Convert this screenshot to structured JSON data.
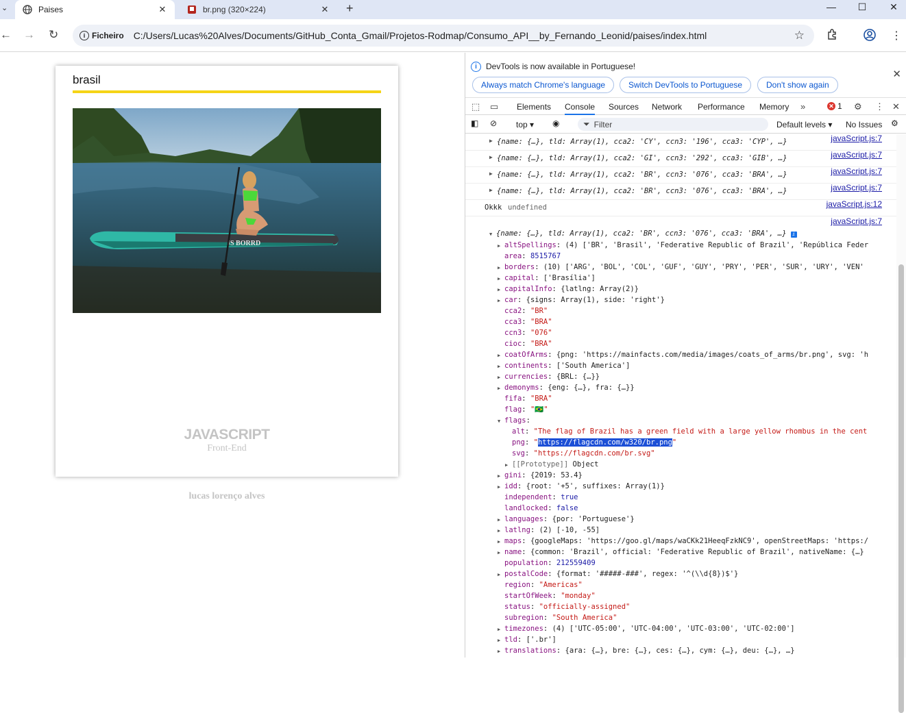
{
  "browser": {
    "tabs": [
      {
        "title": "Paises",
        "active": true
      },
      {
        "title": "br.png (320×224)",
        "active": false
      }
    ],
    "omnibox": {
      "chip": "Ficheiro",
      "url": "C:/Users/Lucas%20Alves/Documents/GitHub_Conta_Gmail/Projetos-Rodmap/Consumo_API__by_Fernando_Leonid/paises/index.html"
    }
  },
  "page": {
    "search_value": "brasil",
    "brand_main": "JAVASCRIPT",
    "brand_sub": "Front-End",
    "author": "lucas lorenço alves",
    "photo_text": "JS BORRD"
  },
  "devtools": {
    "info_message": "DevTools is now available in Portuguese!",
    "buttons": [
      "Always match Chrome's language",
      "Switch DevTools to Portuguese",
      "Don't show again"
    ],
    "tabs": [
      "Elements",
      "Console",
      "Sources",
      "Network",
      "Performance",
      "Memory"
    ],
    "error_count": "1",
    "context": "top",
    "filter_placeholder": "Filter",
    "levels": "Default levels",
    "issues": "No Issues"
  },
  "console": {
    "summary_rows": [
      {
        "text": "{name: {…}, tld: Array(1), cca2: 'CY', ccn3: '196', cca3: 'CYP', …}",
        "source": "javaScript.js:7"
      },
      {
        "text": "{name: {…}, tld: Array(1), cca2: 'GI', ccn3: '292', cca3: 'GIB', …}",
        "source": "javaScript.js:7"
      },
      {
        "text": "{name: {…}, tld: Array(1), cca2: 'BR', ccn3: '076', cca3: 'BRA', …}",
        "source": "javaScript.js:7"
      },
      {
        "text": "{name: {…}, tld: Array(1), cca2: 'BR', ccn3: '076', cca3: 'BRA', …}",
        "source": "javaScript.js:7"
      }
    ],
    "okkk": {
      "label": "Okkk",
      "value": "undefined",
      "source": "javaScript.js:12"
    },
    "expanded_source": "javaScript.js:7",
    "expanded_header": "{name: {…}, tld: Array(1), cca2: 'BR', ccn3: '076', cca3: 'BRA', …}",
    "props": [
      {
        "t": 1,
        "k": "altSpellings",
        "v": "(4) ['BR', 'Brasil', 'Federative Republic of Brazil', 'República Feder"
      },
      {
        "t": 0,
        "k": "area",
        "v": "8515767"
      },
      {
        "t": 1,
        "k": "borders",
        "v": "(10) ['ARG', 'BOL', 'COL', 'GUF', 'GUY', 'PRY', 'PER', 'SUR', 'URY', 'VEN'"
      },
      {
        "t": 1,
        "k": "capital",
        "v": "['Brasília']"
      },
      {
        "t": 1,
        "k": "capitalInfo",
        "v": "{latlng: Array(2)}"
      },
      {
        "t": 1,
        "k": "car",
        "v": "{signs: Array(1), side: 'right'}"
      },
      {
        "t": 0,
        "k": "cca2",
        "v": "\"BR\""
      },
      {
        "t": 0,
        "k": "cca3",
        "v": "\"BRA\""
      },
      {
        "t": 0,
        "k": "ccn3",
        "v": "\"076\""
      },
      {
        "t": 0,
        "k": "cioc",
        "v": "\"BRA\""
      },
      {
        "t": 1,
        "k": "coatOfArms",
        "v": "{png: 'https://mainfacts.com/media/images/coats_of_arms/br.png', svg: 'h"
      },
      {
        "t": 1,
        "k": "continents",
        "v": "['South America']"
      },
      {
        "t": 1,
        "k": "currencies",
        "v": "{BRL: {…}}"
      },
      {
        "t": 1,
        "k": "demonyms",
        "v": "{eng: {…}, fra: {…}}"
      },
      {
        "t": 0,
        "k": "fifa",
        "v": "\"BRA\""
      },
      {
        "t": 0,
        "k": "flag",
        "v": "\"🇧🇷\""
      },
      {
        "t": 2,
        "k": "flags",
        "v": ""
      },
      {
        "t": 3,
        "k": "alt",
        "v": "\"The flag of Brazil has a green field with a large yellow rhombus in the cent"
      },
      {
        "t": 4,
        "k": "png",
        "v": "https://flagcdn.com/w320/br.png"
      },
      {
        "t": 3,
        "k": "svg",
        "v": "\"https://flagcdn.com/br.svg\""
      },
      {
        "t": 5,
        "k": "[[Prototype]]",
        "v": "Object"
      },
      {
        "t": 1,
        "k": "gini",
        "v": "{2019: 53.4}"
      },
      {
        "t": 1,
        "k": "idd",
        "v": "{root: '+5', suffixes: Array(1)}"
      },
      {
        "t": 0,
        "k": "independent",
        "v": "true"
      },
      {
        "t": 0,
        "k": "landlocked",
        "v": "false"
      },
      {
        "t": 1,
        "k": "languages",
        "v": "{por: 'Portuguese'}"
      },
      {
        "t": 1,
        "k": "latlng",
        "v": "(2) [-10, -55]"
      },
      {
        "t": 1,
        "k": "maps",
        "v": "{googleMaps: 'https://goo.gl/maps/waCKk21HeeqFzkNC9', openStreetMaps: 'https:/"
      },
      {
        "t": 1,
        "k": "name",
        "v": "{common: 'Brazil', official: 'Federative Republic of Brazil', nativeName: {…}"
      },
      {
        "t": 0,
        "k": "population",
        "v": "212559409"
      },
      {
        "t": 1,
        "k": "postalCode",
        "v": "{format: '#####-###', regex: '^(\\\\d{8})$'}"
      },
      {
        "t": 0,
        "k": "region",
        "v": "\"Americas\""
      },
      {
        "t": 0,
        "k": "startOfWeek",
        "v": "\"monday\""
      },
      {
        "t": 0,
        "k": "status",
        "v": "\"officially-assigned\""
      },
      {
        "t": 0,
        "k": "subregion",
        "v": "\"South America\""
      },
      {
        "t": 1,
        "k": "timezones",
        "v": "(4) ['UTC-05:00', 'UTC-04:00', 'UTC-03:00', 'UTC-02:00']"
      },
      {
        "t": 1,
        "k": "tld",
        "v": "['.br']"
      },
      {
        "t": 1,
        "k": "translations",
        "v": "{ara: {…}, bre: {…}, ces: {…}, cym: {…}, deu: {…}, …}"
      }
    ]
  }
}
